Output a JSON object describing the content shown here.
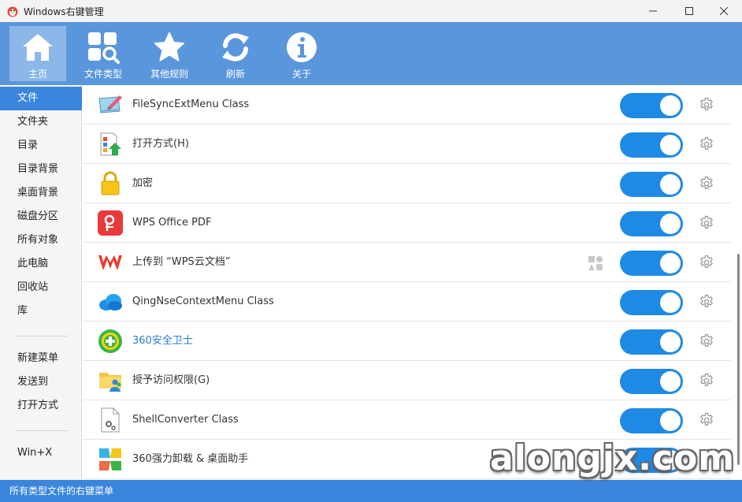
{
  "window": {
    "title": "Windows右键管理"
  },
  "toolbar": {
    "items": [
      {
        "label": "主页",
        "icon": "home-icon"
      },
      {
        "label": "文件类型",
        "icon": "file-types-icon"
      },
      {
        "label": "其他规则",
        "icon": "star-icon"
      },
      {
        "label": "刷新",
        "icon": "refresh-icon"
      },
      {
        "label": "关于",
        "icon": "info-icon"
      }
    ]
  },
  "sidebar": {
    "items": [
      {
        "label": "文件",
        "active": true
      },
      {
        "label": "文件夹"
      },
      {
        "label": "目录"
      },
      {
        "label": "目录背景"
      },
      {
        "label": "桌面背景"
      },
      {
        "label": "磁盘分区"
      },
      {
        "label": "所有对象"
      },
      {
        "label": "此电脑"
      },
      {
        "label": "回收站"
      },
      {
        "label": "库"
      },
      {
        "label": "新建菜单"
      },
      {
        "label": "发送到"
      },
      {
        "label": "打开方式"
      },
      {
        "label": "Win+X"
      }
    ]
  },
  "list": {
    "rows": [
      {
        "label": "FileSyncExtMenu Class",
        "icon": "filesync-icon",
        "enabled": true
      },
      {
        "label": "打开方式(H)",
        "icon": "open-with-icon",
        "enabled": true
      },
      {
        "label": "加密",
        "icon": "lock-icon",
        "enabled": true
      },
      {
        "label": "WPS Office PDF",
        "icon": "wps-pdf-icon",
        "enabled": true
      },
      {
        "label": "上传到 “WPS云文档”",
        "icon": "wps-icon",
        "enabled": true,
        "extra_icon": "shapes-icon"
      },
      {
        "label": "QingNseContextMenu Class",
        "icon": "cloud-icon",
        "enabled": true
      },
      {
        "label": "360安全卫士",
        "icon": "360-safe-icon",
        "enabled": true,
        "link": true
      },
      {
        "label": "授予访问权限(G)",
        "icon": "share-folder-icon",
        "enabled": true
      },
      {
        "label": "ShellConverter Class",
        "icon": "settings-file-icon",
        "enabled": true
      },
      {
        "label": "360强力卸载 & 桌面助手",
        "icon": "360-uninstall-icon",
        "enabled": true
      }
    ]
  },
  "status": {
    "text": "所有类型文件的右键菜单"
  },
  "watermark": {
    "text": "alongjx.com"
  },
  "colors": {
    "toolbar_bg": "#5a96dc",
    "accent": "#3b86dd",
    "toggle_on": "#1e8ae6"
  }
}
